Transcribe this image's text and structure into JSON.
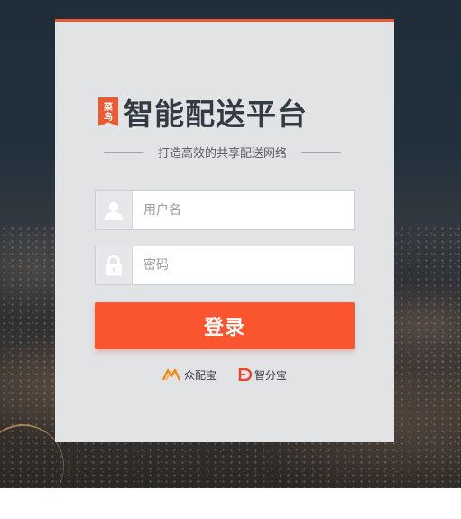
{
  "brand": {
    "badge_top": "菜",
    "badge_bottom": "鸟",
    "title": "智能配送平台",
    "tagline": "打造高效的共享配送网络",
    "accent_color": "#ea5a35"
  },
  "login_form": {
    "username": {
      "placeholder": "用户名",
      "value": "",
      "icon": "user-icon"
    },
    "password": {
      "placeholder": "密码",
      "value": "",
      "icon": "lock-icon"
    },
    "submit_label": "登录",
    "button_color": "#fb5530"
  },
  "partners": [
    {
      "label": "众配宝",
      "icon": "zhongpeibao-logo-icon",
      "color": "#f08a1c"
    },
    {
      "label": "智分宝",
      "icon": "zhifenbao-logo-icon",
      "color": "#e8452c"
    }
  ]
}
